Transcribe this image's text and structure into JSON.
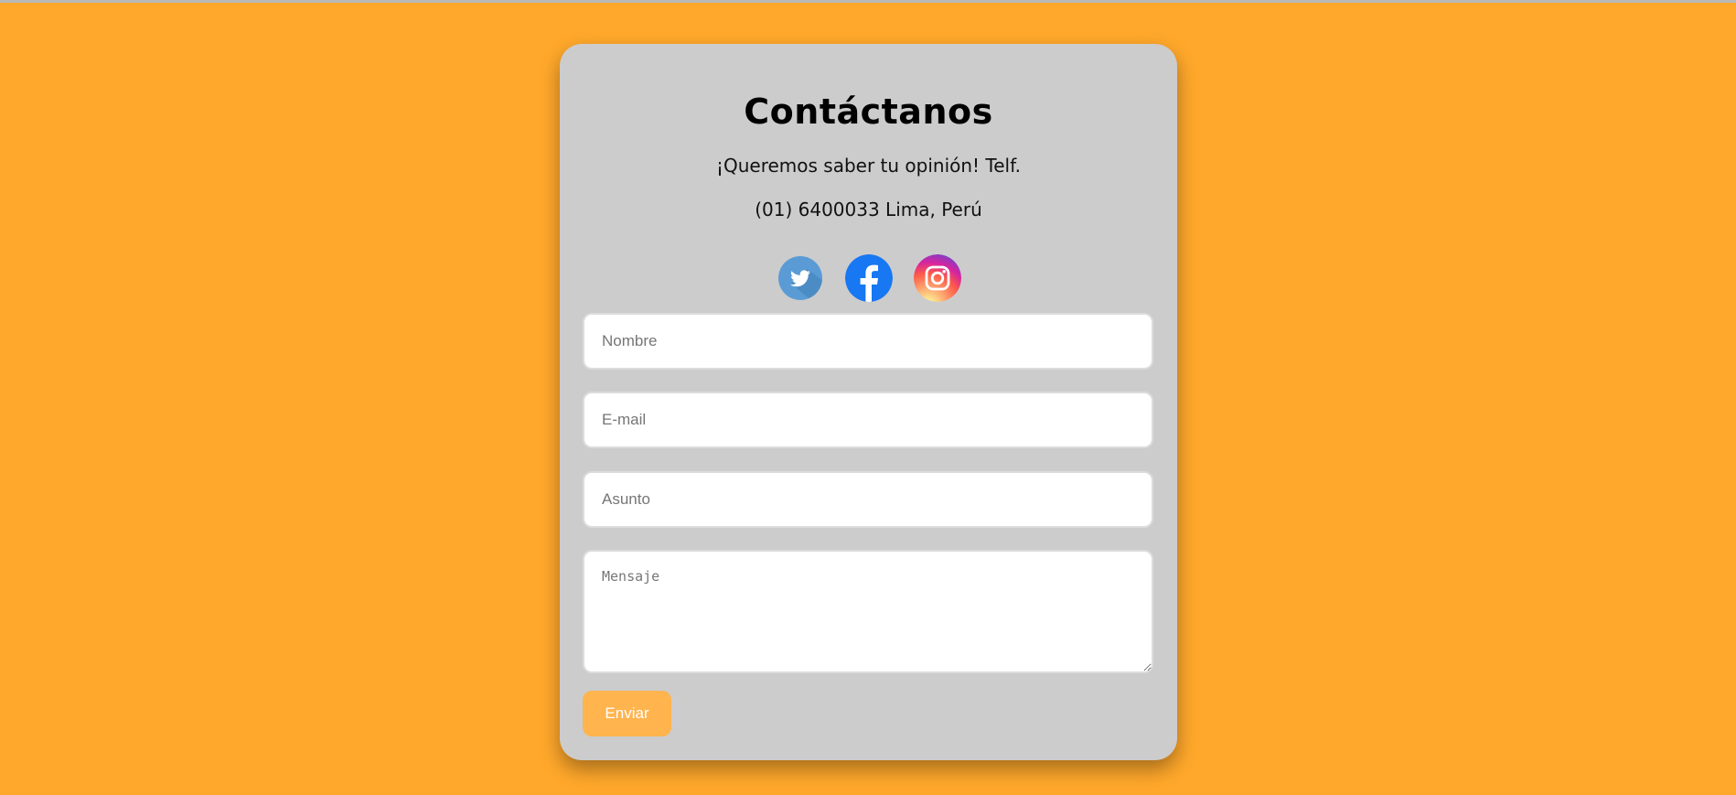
{
  "page": {
    "background_color": "#FFA82B",
    "card_color": "#CCCCCC",
    "accent_button_color": "#FFB44E"
  },
  "contact": {
    "title": "Contáctanos",
    "line1": "¡Queremos saber tu opinión! Telf.",
    "line2": "(01) 6400033 Lima, Perú"
  },
  "socials": [
    {
      "name": "twitter-icon",
      "color": "#5B9BD5"
    },
    {
      "name": "facebook-icon",
      "color": "#1877F2"
    },
    {
      "name": "instagram-icon",
      "color": "#D62976"
    }
  ],
  "form": {
    "name_placeholder": "Nombre",
    "email_placeholder": "E-mail",
    "subject_placeholder": "Asunto",
    "message_placeholder": "Mensaje",
    "submit_label": "Enviar"
  }
}
